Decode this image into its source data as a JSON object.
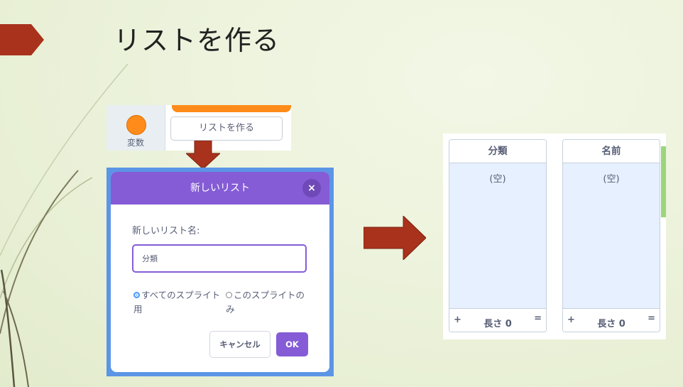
{
  "slide": {
    "title": "リストを作る",
    "accent_color": "#a8321c"
  },
  "category": {
    "label": "変数",
    "color": "#ff8c1a"
  },
  "make_list_button": {
    "label": "リストを作る"
  },
  "dialog": {
    "title": "新しいリスト",
    "close_icon": "×",
    "field_label": "新しいリスト名:",
    "input_value": "分類",
    "radio_all_sprites": "すべてのスプライト用",
    "radio_this_sprite": "このスプライトのみ",
    "cancel_label": "キャンセル",
    "ok_label": "OK",
    "header_color": "#855cd6"
  },
  "lists": [
    {
      "name": "分類",
      "empty_text": "(空)",
      "add_icon": "+",
      "length_text": "長さ 0",
      "resize_icon": "="
    },
    {
      "name": "名前",
      "empty_text": "(空)",
      "add_icon": "+",
      "length_text": "長さ 0",
      "resize_icon": "="
    }
  ]
}
